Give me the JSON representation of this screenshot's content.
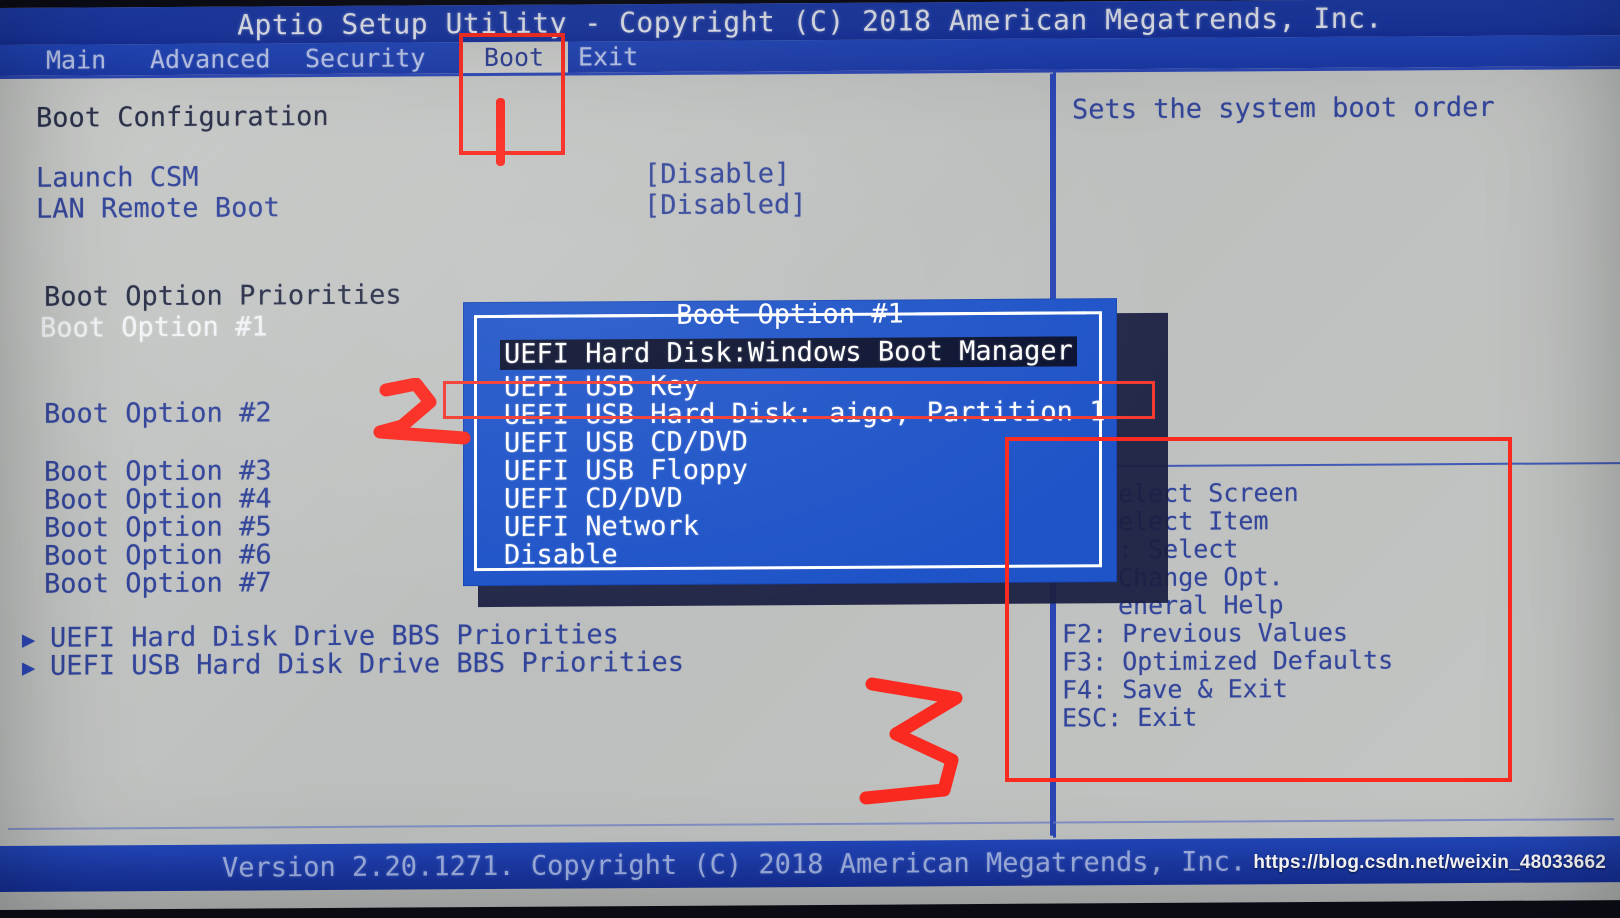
{
  "window": {
    "title": "Aptio Setup Utility - Copyright (C) 2018 American Megatrends, Inc.",
    "status_bar": "Version 2.20.1271. Copyright (C) 2018 American Megatrends, Inc.",
    "watermark": "https://blog.csdn.net/weixin_48033662"
  },
  "menu": {
    "items": [
      {
        "label": "Main",
        "active": false
      },
      {
        "label": "Advanced",
        "active": false
      },
      {
        "label": "Security",
        "active": false
      },
      {
        "label": "Boot",
        "active": true
      },
      {
        "label": "Exit",
        "active": false
      }
    ]
  },
  "main": {
    "section_title": "Boot Configuration",
    "settings": [
      {
        "label": "Launch CSM",
        "value": "[Disable]"
      },
      {
        "label": "LAN Remote Boot",
        "value": "[Disabled]"
      }
    ],
    "priorities_title": "Boot Option Priorities",
    "boot_options": [
      {
        "label": "Boot Option #1",
        "highlighted": true
      },
      {
        "label": "Boot Option #2",
        "highlighted": false
      },
      {
        "label": "Boot Option #3",
        "highlighted": false
      },
      {
        "label": "Boot Option #4",
        "highlighted": false
      },
      {
        "label": "Boot Option #5",
        "highlighted": false
      },
      {
        "label": "Boot Option #6",
        "highlighted": false
      },
      {
        "label": "Boot Option #7",
        "highlighted": false
      }
    ],
    "submenus": [
      {
        "arrow": "▶",
        "label": "UEFI Hard Disk Drive BBS Priorities"
      },
      {
        "arrow": "▶",
        "label": "UEFI USB Hard Disk Drive BBS Priorities"
      }
    ]
  },
  "dialog": {
    "title": "Boot Option #1",
    "options": [
      {
        "label": "UEFI Hard Disk:Windows Boot Manager",
        "selected": true
      },
      {
        "label": "UEFI USB Key",
        "selected": false
      },
      {
        "label": "UEFI USB Hard Disk: aigo, Partition 1",
        "selected": false
      },
      {
        "label": "UEFI USB CD/DVD",
        "selected": false
      },
      {
        "label": "UEFI USB Floppy",
        "selected": false
      },
      {
        "label": "UEFI CD/DVD",
        "selected": false
      },
      {
        "label": "UEFI Network",
        "selected": false
      },
      {
        "label": "Disable",
        "selected": false
      }
    ]
  },
  "help": {
    "description": "Sets the system boot order",
    "keys": [
      {
        "text": "elect Screen",
        "occluded": true
      },
      {
        "text": "elect Item",
        "occluded": true
      },
      {
        "text": ": Select",
        "occluded": true
      },
      {
        "text": "Change Opt.",
        "occluded": true
      },
      {
        "text": "eneral Help",
        "occluded": true
      },
      {
        "text": "F2: Previous Values",
        "occluded": false
      },
      {
        "text": "F3: Optimized Defaults",
        "occluded": false
      },
      {
        "text": "F4: Save & Exit",
        "occluded": false
      },
      {
        "text": "ESC: Exit",
        "occluded": false
      }
    ]
  },
  "annotations": {
    "color": "#fb2a20",
    "marks": [
      {
        "name": "step-1-marker",
        "kind": "box-and-stroke",
        "target": "Boot tab"
      },
      {
        "name": "step-2-marker",
        "kind": "digit-2",
        "target": "UEFI USB Hard Disk: aigo, Partition 1"
      },
      {
        "name": "step-3-marker",
        "kind": "digit-3",
        "target": "hotkey legend"
      }
    ]
  },
  "theme": {
    "screen_bg": "#bfc2c0",
    "title_blue": "#1b38a4",
    "text_blue": "#33459a",
    "dialog_blue": "#1f54c8",
    "selected_bg": "#0b1230",
    "annotation_red": "#fb2a20"
  }
}
